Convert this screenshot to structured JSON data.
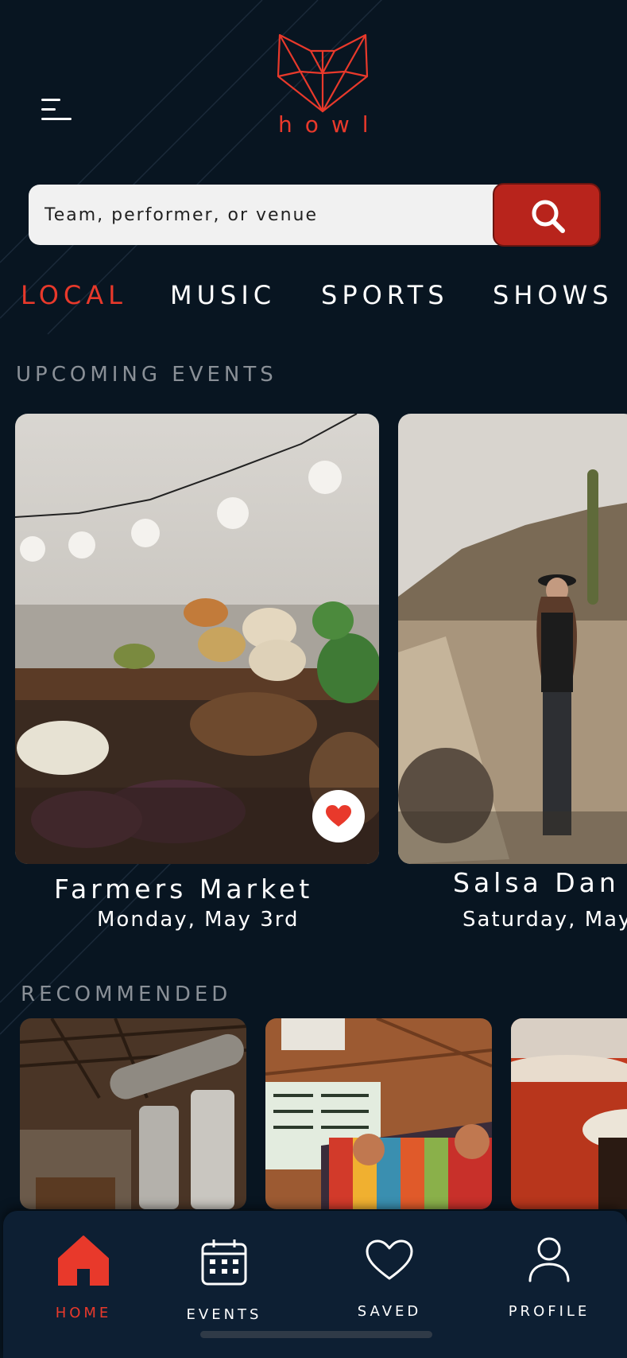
{
  "header": {
    "logo_text": "howl",
    "menu_icon": "hamburger-menu-icon"
  },
  "search": {
    "placeholder": "Team, performer, or venue",
    "button_icon": "search-icon"
  },
  "tabs": [
    {
      "label": "LOCAL",
      "active": true
    },
    {
      "label": "MUSIC",
      "active": false
    },
    {
      "label": "SPORTS",
      "active": false
    },
    {
      "label": "SHOWS",
      "active": false
    }
  ],
  "sections": {
    "upcoming": "UPCOMING EVENTS",
    "recommended": "RECOMMENDED"
  },
  "events": [
    {
      "title": "Farmers Market",
      "date": "Monday, May 3rd",
      "favorited": true
    },
    {
      "title": "Salsa Dan",
      "date": "Saturday, May"
    }
  ],
  "bottom_nav": [
    {
      "label": "HOME",
      "icon": "home-icon",
      "active": true
    },
    {
      "label": "EVENTS",
      "icon": "calendar-icon",
      "active": false
    },
    {
      "label": "SAVED",
      "icon": "heart-icon",
      "active": false
    },
    {
      "label": "PROFILE",
      "icon": "user-icon",
      "active": false
    }
  ],
  "colors": {
    "background": "#081521",
    "accent": "#e8392b",
    "search_button": "#b8241c",
    "nav_background": "#0d1f33"
  }
}
